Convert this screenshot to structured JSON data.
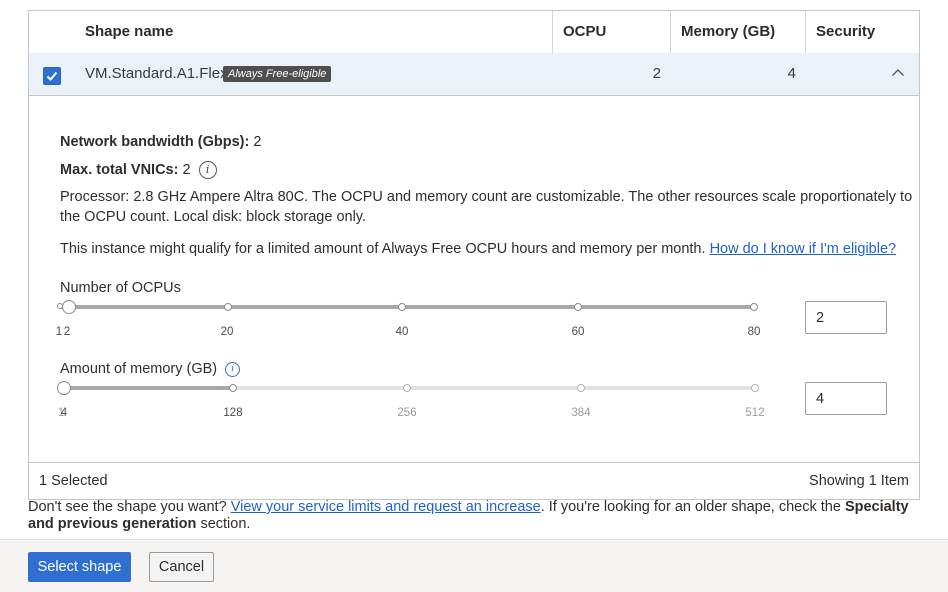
{
  "table": {
    "columns": [
      "Shape name",
      "OCPU",
      "Memory (GB)",
      "Security"
    ],
    "row": {
      "shape_name": "VM.Standard.A1.Flex",
      "badge": "Always Free-eligible",
      "ocpu": "2",
      "memory": "4",
      "selected": true
    }
  },
  "details": {
    "bandwidth_label": "Network bandwidth (Gbps):",
    "bandwidth_value": "2",
    "vnics_label": "Max. total VNICs:",
    "vnics_value": "2",
    "processor_line1": "Processor: 2.8 GHz Ampere Altra 80C. The OCPU and memory count are customizable. The other resources scale proportionately to",
    "processor_line2": "the OCPU count. Local disk: block storage only.",
    "free_text": "This instance might qualify for a limited amount of Always Free OCPU hours and memory per month.",
    "free_link": "How do I know if I'm eligible?"
  },
  "ocpu_slider": {
    "label": "Number of OCPUs",
    "min_label": "1",
    "value_label": "2",
    "ticks": [
      "20",
      "40",
      "60",
      "80"
    ],
    "min": 1,
    "max": 80,
    "value": 2,
    "input_value": "2"
  },
  "memory_slider": {
    "label": "Amount of memory (GB)",
    "min_label": "1",
    "value_label": "4",
    "ticks": [
      "128",
      "256",
      "384",
      "512"
    ],
    "max_allowed": 128,
    "max": 512,
    "value": 4,
    "input_value": "4"
  },
  "footer": {
    "selected": "1 Selected",
    "showing": "Showing 1 Item"
  },
  "note": {
    "prefix": "Don't see the shape you want?",
    "link": "View your service limits and request an increase",
    "middle": ". If you're looking for an older shape, check the",
    "bold": "Specialty and previous generation",
    "suffix": "section."
  },
  "buttons": {
    "select": "Select shape",
    "cancel": "Cancel"
  },
  "colors": {
    "primary": "#2f6fd0",
    "selected_row": "#ebf1f8",
    "link": "#1d63c9",
    "badge": "#4f4f4f"
  }
}
